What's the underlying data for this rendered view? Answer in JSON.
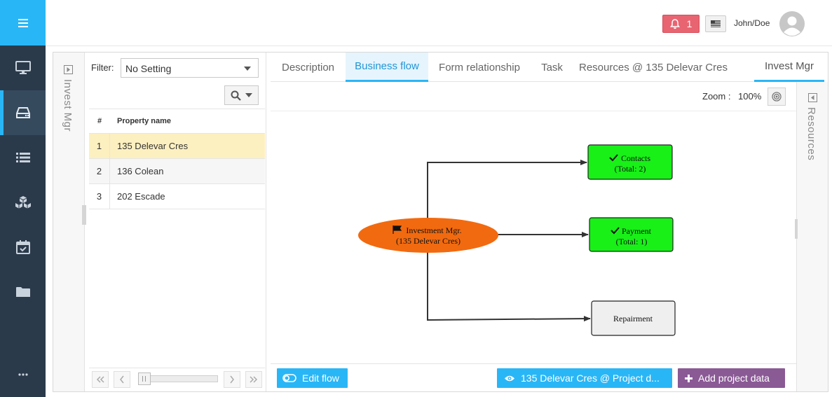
{
  "colors": {
    "sidebar_bg": "#2b3a4a",
    "brand_bg": "#29b6f6",
    "accent": "#29b6f6",
    "notification": "#e96471",
    "selected_row": "#fdf0c0",
    "node_done": "#18f018",
    "node_pending": "#efefef",
    "start_node": "#f26a0f",
    "add_button": "#8a5a95"
  },
  "sidebar": {
    "menu_icon": "hamburger-icon",
    "items": [
      {
        "icon": "monitor-icon"
      },
      {
        "icon": "inbox-icon",
        "active": true
      },
      {
        "icon": "list-icon"
      },
      {
        "icon": "cubes-icon"
      },
      {
        "icon": "calendar-check-icon"
      },
      {
        "icon": "folder-icon"
      }
    ],
    "more_icon": "more-icon"
  },
  "header": {
    "notification_count": "1",
    "user_name": "John/Doe"
  },
  "left_collapse": {
    "label": "Invest Mgr"
  },
  "list": {
    "filter_label": "Filter:",
    "filter_value": "No Setting",
    "columns": [
      "#",
      "Property name"
    ],
    "rows": [
      {
        "num": "1",
        "name": "135 Delevar Cres"
      },
      {
        "num": "2",
        "name": "136 Colean"
      },
      {
        "num": "3",
        "name": "202 Escade"
      }
    ]
  },
  "tabs": {
    "description": "Description",
    "business_flow": "Business flow",
    "form_relationship": "Form relationship",
    "task": "Task",
    "resources": "Resources @ 135 Delevar Cres",
    "invest_mgr": "Invest Mgr"
  },
  "zoom": {
    "label": "Zoom :",
    "value": "100%"
  },
  "flow": {
    "start": {
      "line1": "Investment Mgr.",
      "line2": "(135 Delevar Cres)"
    },
    "contacts": {
      "line1": "Contacts",
      "line2": "(Total: 2)"
    },
    "payment": {
      "line1": "Payment",
      "line2": "(Total: 1)"
    },
    "repairment": {
      "line1": "Repairment"
    }
  },
  "footer": {
    "edit_flow": "Edit flow",
    "view_project": "135 Delevar Cres @ Project d...",
    "add_project": "Add project data"
  },
  "right_collapse": {
    "label": "Resources"
  }
}
